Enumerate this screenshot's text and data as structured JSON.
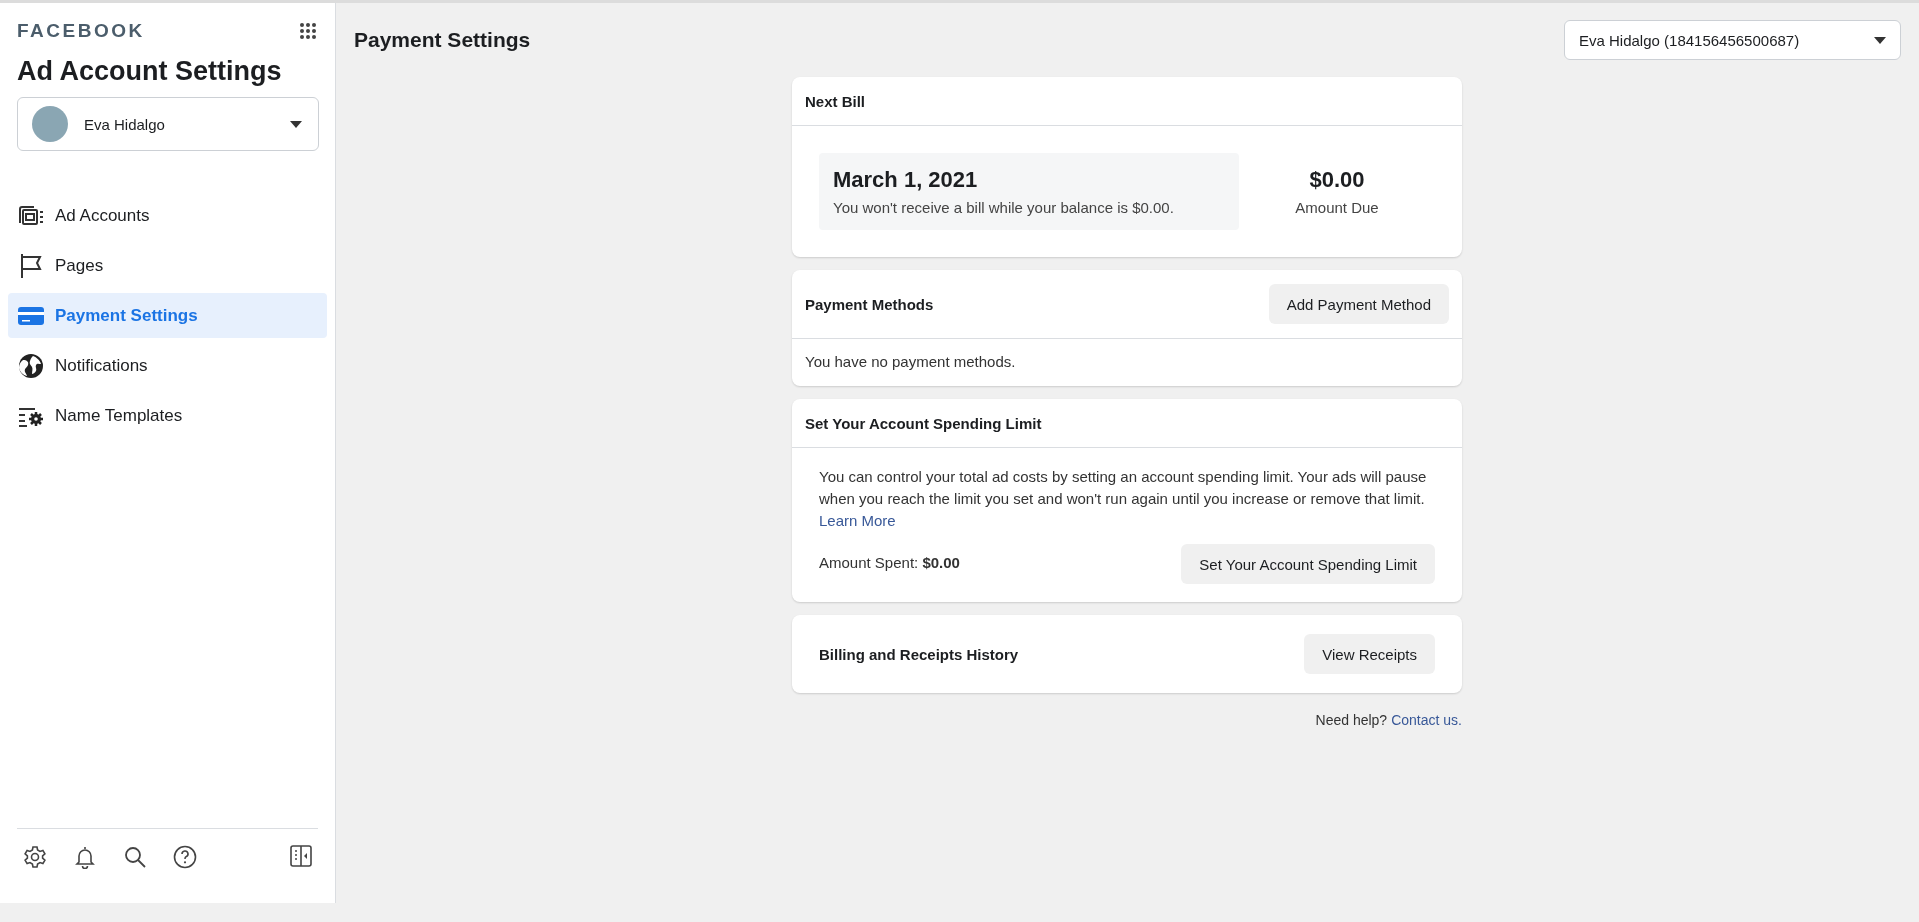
{
  "brand": "FACEBOOK",
  "sidebar": {
    "title": "Ad Account Settings",
    "account": {
      "name": "Eva Hidalgo"
    },
    "items": [
      {
        "label": "Ad Accounts",
        "kind": "accounts",
        "selected": false
      },
      {
        "label": "Pages",
        "kind": "pages",
        "selected": false
      },
      {
        "label": "Payment Settings",
        "kind": "payment",
        "selected": true
      },
      {
        "label": "Notifications",
        "kind": "notifications",
        "selected": false
      },
      {
        "label": "Name Templates",
        "kind": "templates",
        "selected": false
      }
    ]
  },
  "header": {
    "title": "Payment Settings",
    "account_selector": "Eva Hidalgo (184156456500687)"
  },
  "next_bill": {
    "title": "Next Bill",
    "date": "March 1, 2021",
    "note": "You won't receive a bill while your balance is $0.00.",
    "amount": "$0.00",
    "amount_label": "Amount Due"
  },
  "payment_methods": {
    "title": "Payment Methods",
    "button": "Add Payment Method",
    "empty_text": "You have no payment methods."
  },
  "spending_limit": {
    "title": "Set Your Account Spending Limit",
    "description": "You can control your total ad costs by setting an account spending limit. Your ads will pause when you reach the limit you set and won't run again until you increase or remove that limit.",
    "link": "Learn More",
    "amount_spent": "Amount Spent: **$0.00**",
    "button": "Set Your Account Spending Limit"
  },
  "billing_history": {
    "title": "Billing and Receipts History",
    "button": "View Receipts"
  },
  "help": {
    "text": "Need help?",
    "link": "Contact us."
  }
}
